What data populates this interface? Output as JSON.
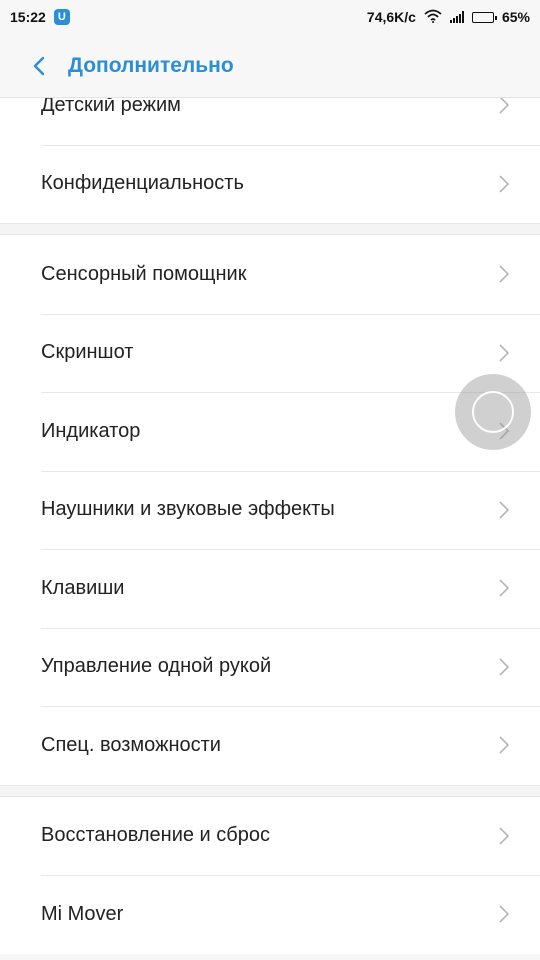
{
  "status_bar": {
    "time": "15:22",
    "app_badge": "U",
    "network_speed": "74,6K/c",
    "battery_percent": "65%",
    "battery_level": 0.65
  },
  "header": {
    "title": "Дополнительно"
  },
  "sections": [
    {
      "items": [
        {
          "label": "Детский режим"
        },
        {
          "label": "Конфиденциальность"
        }
      ]
    },
    {
      "items": [
        {
          "label": "Сенсорный помощник"
        },
        {
          "label": "Скриншот"
        },
        {
          "label": "Индикатор"
        },
        {
          "label": "Наушники и звуковые эффекты"
        },
        {
          "label": "Клавиши"
        },
        {
          "label": "Управление одной рукой"
        },
        {
          "label": "Спец. возможности"
        }
      ]
    },
    {
      "items": [
        {
          "label": "Восстановление и сброс"
        },
        {
          "label": "Mi Mover"
        }
      ]
    }
  ],
  "colors": {
    "accent": "#2a8fd4",
    "chevron": "#b5b5b5"
  }
}
